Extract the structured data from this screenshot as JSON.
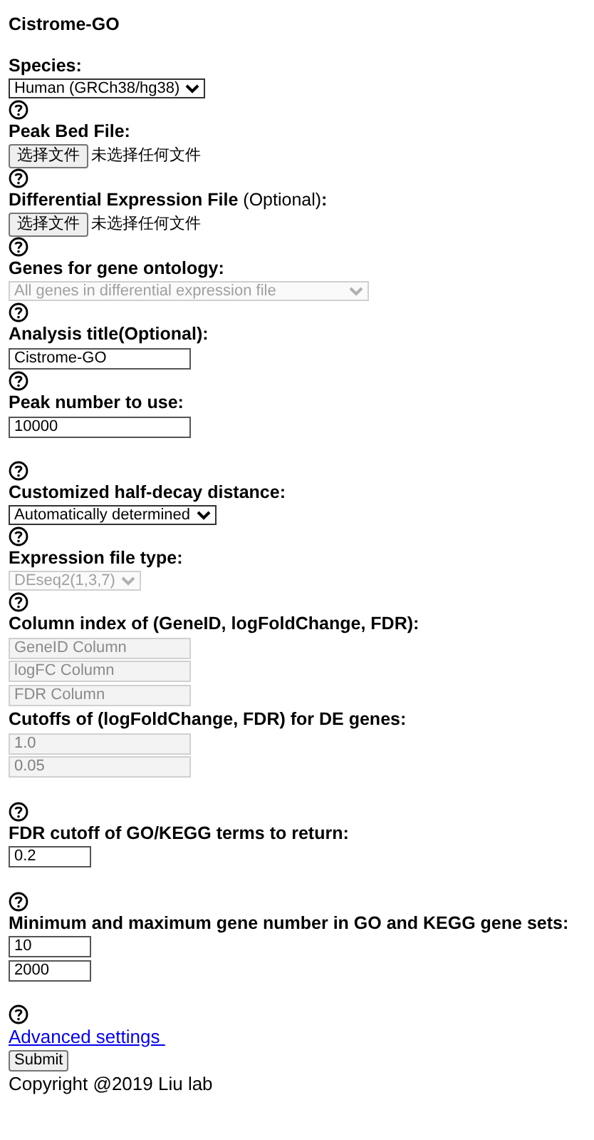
{
  "title": "Cistrome-GO",
  "sections": [
    {
      "label": "Species:",
      "help": true,
      "blank_after": false,
      "controls": [
        {
          "kind": "select",
          "value": "Human (GRCh38/hg38)",
          "disabled": false
        }
      ]
    },
    {
      "label": "Peak Bed File:",
      "help": true,
      "blank_after": false,
      "controls": [
        {
          "kind": "file",
          "button": "选择文件",
          "status": "未选择任何文件"
        }
      ]
    },
    {
      "label": "Differential Expression File",
      "note": "(Optional)",
      "suffix": ":",
      "help": true,
      "blank_after": false,
      "controls": [
        {
          "kind": "file",
          "button": "选择文件",
          "status": "未选择任何文件"
        }
      ]
    },
    {
      "label": "Genes for gene ontology:",
      "help": true,
      "blank_after": false,
      "controls": [
        {
          "kind": "wide_select",
          "value": "All genes in differential expression file",
          "disabled": true
        }
      ]
    },
    {
      "label": "Analysis title(Optional):",
      "help": true,
      "blank_after": false,
      "controls": [
        {
          "kind": "input",
          "value": "Cistrome-GO",
          "disabled": false
        }
      ]
    },
    {
      "label": "Peak number to use:",
      "help": true,
      "blank_after": true,
      "controls": [
        {
          "kind": "input",
          "value": "10000",
          "disabled": false
        }
      ]
    },
    {
      "label": "Customized half-decay distance:",
      "help": true,
      "blank_after": false,
      "controls": [
        {
          "kind": "select",
          "value": "Automatically determined",
          "disabled": false
        }
      ]
    },
    {
      "label": "Expression file type:",
      "help": true,
      "blank_after": false,
      "controls": [
        {
          "kind": "select",
          "value": "DEseq2(1,3,7)",
          "disabled": true
        }
      ]
    },
    {
      "label": "Column index of (GeneID, logFoldChange, FDR):",
      "help": false,
      "blank_after": false,
      "controls": [
        {
          "kind": "input",
          "placeholder": "GeneID Column",
          "disabled": true
        },
        {
          "kind": "input",
          "placeholder": "logFC Column",
          "disabled": true
        },
        {
          "kind": "input",
          "placeholder": "FDR Column",
          "disabled": true
        }
      ]
    },
    {
      "label": "Cutoffs of (logFoldChange, FDR) for DE genes:",
      "help": true,
      "blank_after": true,
      "controls": [
        {
          "kind": "input",
          "value": "1.0",
          "disabled": true
        },
        {
          "kind": "input",
          "value": "0.05",
          "disabled": true
        }
      ]
    },
    {
      "label": "FDR cutoff of GO/KEGG terms to return:",
      "help": true,
      "blank_after": true,
      "controls": [
        {
          "kind": "short_input",
          "value": "0.2",
          "disabled": false
        }
      ]
    },
    {
      "label": "Minimum and maximum gene number in GO and KEGG gene sets:",
      "help": true,
      "blank_after": true,
      "controls": [
        {
          "kind": "short_input",
          "value": "10",
          "disabled": false
        },
        {
          "kind": "short_input",
          "value": "2000",
          "disabled": false
        }
      ]
    }
  ],
  "advanced_link": "Advanced settings ",
  "submit": "Submit",
  "copyright": "Copyright @2019 Liu lab"
}
